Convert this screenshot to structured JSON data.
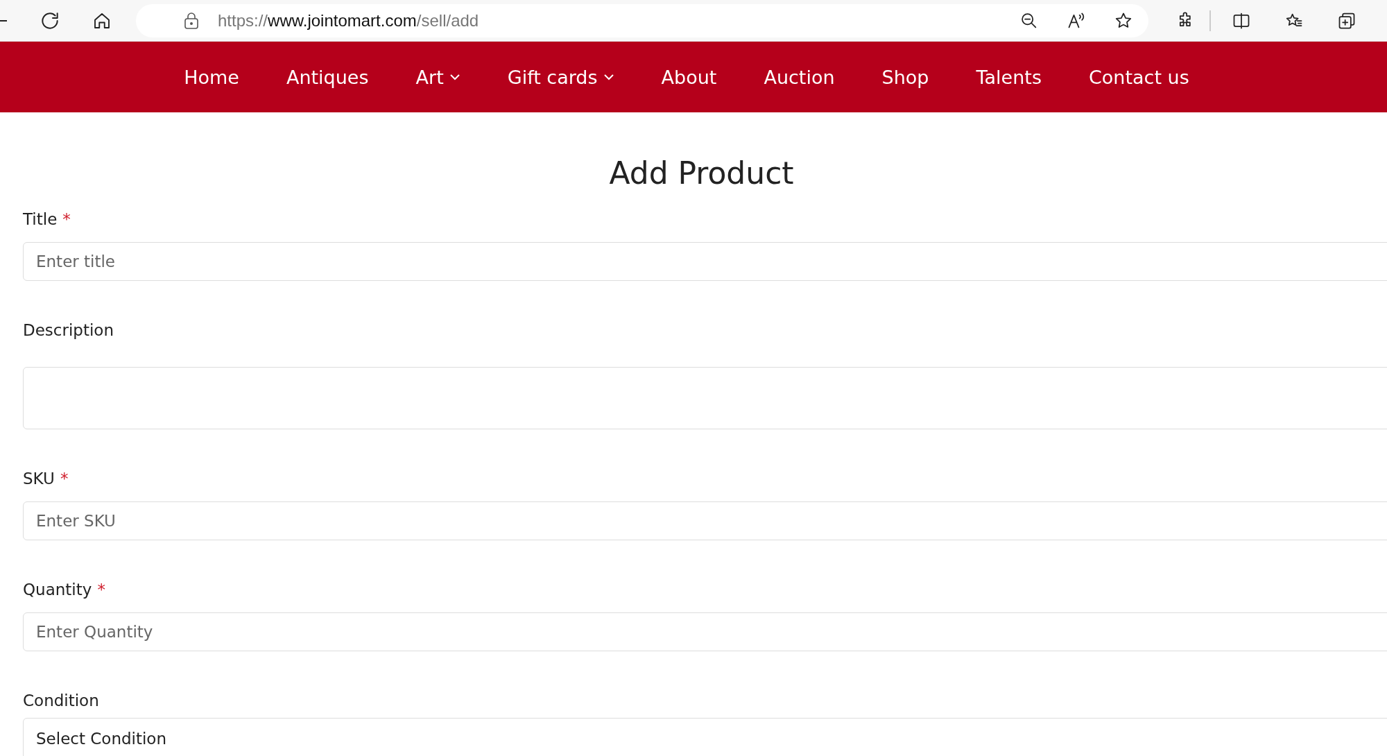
{
  "browser": {
    "url": {
      "scheme": "https://",
      "host": "www.jointomart.com",
      "path": "/sell/add"
    }
  },
  "nav": [
    {
      "label": "Home",
      "dropdown": false
    },
    {
      "label": "Antiques",
      "dropdown": false
    },
    {
      "label": "Art",
      "dropdown": true
    },
    {
      "label": "Gift cards",
      "dropdown": true
    },
    {
      "label": "About",
      "dropdown": false
    },
    {
      "label": "Auction",
      "dropdown": false
    },
    {
      "label": "Shop",
      "dropdown": false
    },
    {
      "label": "Talents",
      "dropdown": false
    },
    {
      "label": "Contact us",
      "dropdown": false
    }
  ],
  "heading": "Add Product",
  "fields": [
    {
      "kind": "input",
      "label": "Title",
      "required_mark": "*",
      "placeholder": "Enter title"
    },
    {
      "kind": "textarea",
      "label": "Description"
    },
    {
      "kind": "input",
      "label": "SKU",
      "required_mark": "*",
      "placeholder": "Enter SKU"
    },
    {
      "kind": "input",
      "label": "Quantity",
      "required_mark": "*",
      "placeholder": "Enter Quantity"
    },
    {
      "kind": "select",
      "label": "Condition",
      "value": "Select Condition"
    }
  ]
}
